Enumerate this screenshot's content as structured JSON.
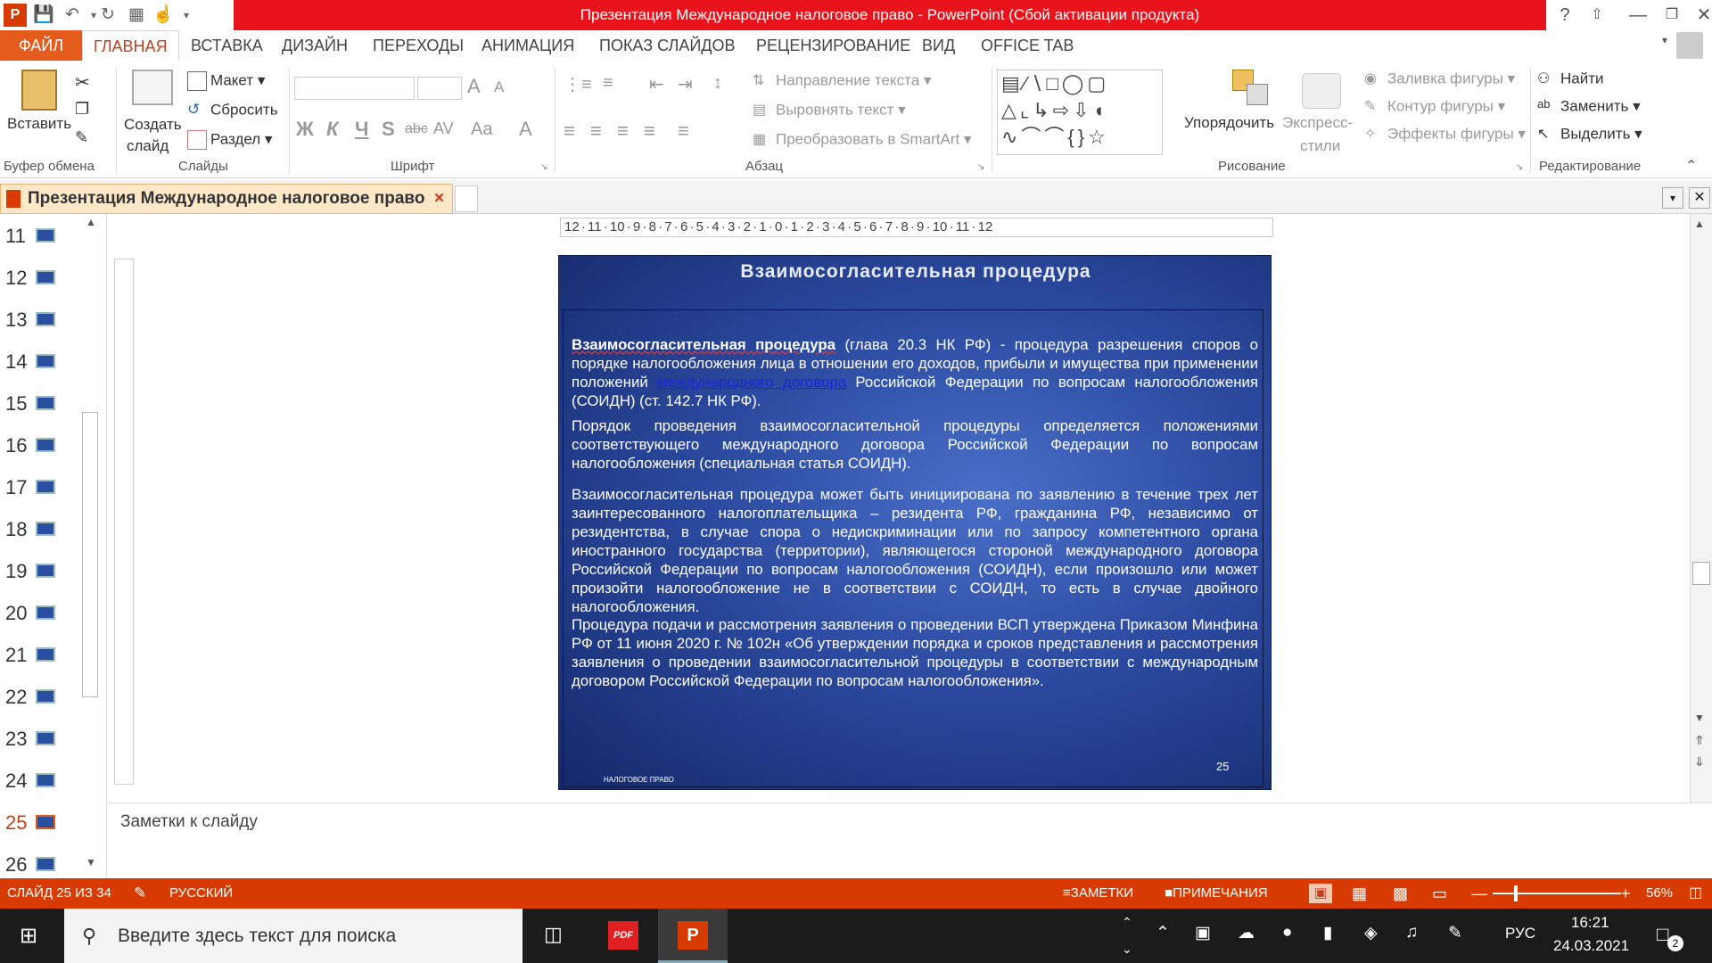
{
  "window": {
    "title": "Презентация Международное налоговое право  -  PowerPoint (Сбой активации продукта)",
    "help": "?"
  },
  "tabs": [
    "ФАЙЛ",
    "ГЛАВНАЯ",
    "ВСТАВКА",
    "ДИЗАЙН",
    "ПЕРЕХОДЫ",
    "АНИМАЦИЯ",
    "ПОКАЗ СЛАЙДОВ",
    "РЕЦЕНЗИРОВАНИЕ",
    "ВИД",
    "OFFICE TAB"
  ],
  "ribbon": {
    "clipboard": {
      "paste": "Вставить",
      "label": "Буфер обмена"
    },
    "slides": {
      "new_slide_1": "Создать",
      "new_slide_2": "слайд",
      "layout": "Макет",
      "reset": "Сбросить",
      "section": "Раздел",
      "label": "Слайды"
    },
    "font": {
      "bold": "Ж",
      "italic": "К",
      "underline": "Ч",
      "shadow": "S",
      "strike": "abc",
      "spacing": "AV",
      "case": "Aa",
      "color": "A",
      "grow": "A",
      "shrink": "A",
      "label": "Шрифт"
    },
    "paragraph": {
      "direction": "Направление текста",
      "align": "Выровнять текст",
      "smartart": "Преобразовать в SmartArt",
      "label": "Абзац"
    },
    "drawing": {
      "arrange": "Упорядочить",
      "express_1": "Экспресс-",
      "express_2": "стили",
      "fill": "Заливка фигуры",
      "outline": "Контур фигуры",
      "effects": "Эффекты фигуры",
      "label": "Рисование"
    },
    "editing": {
      "find": "Найти",
      "replace": "Заменить",
      "select": "Выделить",
      "label": "Редактирование"
    }
  },
  "doc_tab": {
    "title": "Презентация Международное налоговое право",
    "close": "×"
  },
  "thumbnails": [
    {
      "num": "11"
    },
    {
      "num": "12"
    },
    {
      "num": "13"
    },
    {
      "num": "14"
    },
    {
      "num": "15"
    },
    {
      "num": "16"
    },
    {
      "num": "17"
    },
    {
      "num": "18"
    },
    {
      "num": "19"
    },
    {
      "num": "20"
    },
    {
      "num": "21"
    },
    {
      "num": "22"
    },
    {
      "num": "23"
    },
    {
      "num": "24"
    },
    {
      "num": "25",
      "selected": true
    },
    {
      "num": "26"
    }
  ],
  "ruler_h": "12 · 11 · 10 · 9 · 8 · 7 · 6 · 5 · 4 · 3 · 2 · 1 · 0 · 1 · 2 · 3 · 4 · 5 · 6 · 7 · 8 · 9 · 10 · 11 · 12",
  "slide": {
    "title": "Взаимосогласительная процедура",
    "p1_bold": "Взаимосогласительная процедура",
    "p1_a": " (глава 20.3 НК РФ) - процедура разрешения споров о порядке налогообложения лица в отношении его доходов, прибыли и имущества при применении положений ",
    "p1_link": "международного договора",
    "p1_b": " Российской Федерации по вопросам налогообложения (СОИДН) (ст. 142.7 НК РФ).",
    "p2": "Порядок проведения взаимосогласительной процедуры определяется положениями соответствующего международного договора Российской Федерации по вопросам налогообложения (специальная статья СОИДН).",
    "p3": "Взаимосогласительная процедура может быть инициирована по заявлению в течение трех лет заинтересованного налогоплательщика – резидента РФ, гражданина РФ, независимо от резидентства, в случае спора о недискриминации или по запросу компетентного органа иностранного государства (территории), являющегося стороной международного договора Российской Федерации по вопросам налогообложения (СОИДН), если произошло или может произойти налогообложение не в соответствии с СОИДН, то есть в случае двойного налогообложения.",
    "p4": "Процедура подачи и рассмотрения заявления о проведении ВСП утверждена Приказом Минфина РФ от 11 июня 2020 г. № 102н «Об утверждении порядка и сроков представления и рассмотрения заявления о проведении взаимосогласительной процедуры в соответствии с международным договором Российской Федерации по вопросам налогообложения».",
    "footer": "НАЛОГОВОЕ ПРАВО",
    "number": "25"
  },
  "notes": {
    "placeholder": "Заметки к слайду"
  },
  "status": {
    "slide": "СЛАЙД 25 ИЗ 34",
    "lang": "РУССКИЙ",
    "notes": "ЗАМЕТКИ",
    "comments": "ПРИМЕЧАНИЯ",
    "zoom": "56%"
  },
  "taskbar": {
    "search": "Введите здесь текст для поиска",
    "lang": "РУС",
    "time": "16:21",
    "date": "24.03.2021",
    "notif": "2",
    "pdf": "PDF"
  }
}
